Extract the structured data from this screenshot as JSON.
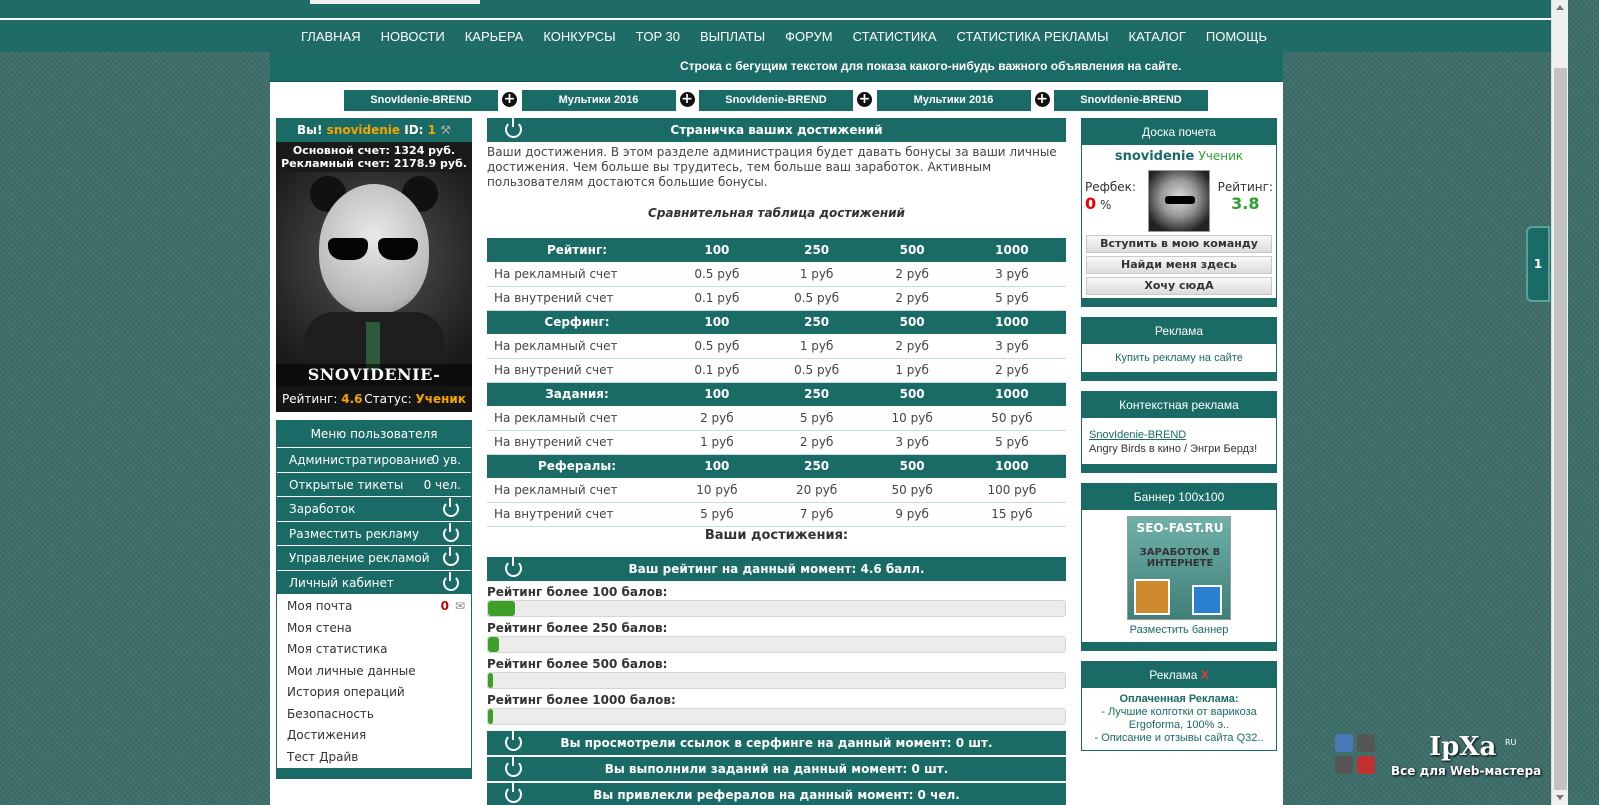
{
  "nav": [
    "ГЛАВНАЯ",
    "НОВОСТИ",
    "КАРЬЕРА",
    "КОНКУРСЫ",
    "TOP 30",
    "ВЫПЛАТЫ",
    "ФОРУМ",
    "СТАТИСТИКА",
    "СТАТИСТИКА РЕКЛАМЫ",
    "КАТАЛОГ",
    "ПОМОЩЬ"
  ],
  "marquee": "Строка с бегущим текстом для показа какого-нибудь важного объявления на сайте.",
  "tabs": [
    "SnovIdenie-BREND",
    "Мультики 2016",
    "SnovIdenie-BREND",
    "Мультики 2016",
    "SnovIdenie-BREND"
  ],
  "user": {
    "greet": "Вы!",
    "name": "snovidenie",
    "id_label": "ID:",
    "id": "1",
    "main_account": "Основной счет: 1324 руб.",
    "ad_account": "Рекламный счет: 2178.9 руб.",
    "avatar_text": "SNOVIDENIE-BREND",
    "rating_label": "Рейтинг:",
    "rating": "4.6",
    "status_label": "Статус:",
    "status": "Ученик"
  },
  "menu": {
    "title": "Меню пользователя",
    "items": [
      {
        "label": "Администратирование",
        "count": "0 ув."
      },
      {
        "label": "Открытые тикеты",
        "count": "0 чел."
      },
      {
        "label": "Заработок"
      },
      {
        "label": "Разместить рекламу"
      },
      {
        "label": "Управление рекламой"
      },
      {
        "label": "Личный кабинет"
      }
    ],
    "sub": [
      "Моя почта",
      "Моя стена",
      "Моя статистика",
      "Мои личные данные",
      "История операций",
      "Безопасность",
      "Достижения",
      "Тест Драйв"
    ],
    "mail_count": "0"
  },
  "center": {
    "header": "Страничка ваших достижений",
    "intro": "Ваши достижения. В этом разделе администрация будет давать бонусы за ваши личные достижения. Чем больше вы трудитесь, тем больше ваш заработок. Активным пользователям достаются большие бонусы.",
    "table_title": "Сравнительная таблица достижений",
    "groups": [
      {
        "name": "Рейтинг:",
        "cols": [
          "100",
          "250",
          "500",
          "1000"
        ],
        "rows": [
          {
            "label": "На рекламный счет",
            "vals": [
              "0.5 руб",
              "1 руб",
              "2 руб",
              "3 руб"
            ]
          },
          {
            "label": "На внутрений счет",
            "vals": [
              "0.1 руб",
              "0.5 руб",
              "2 руб",
              "5 руб"
            ]
          }
        ]
      },
      {
        "name": "Серфинг:",
        "cols": [
          "100",
          "250",
          "500",
          "1000"
        ],
        "rows": [
          {
            "label": "На рекламный счет",
            "vals": [
              "0.5 руб",
              "1 руб",
              "2 руб",
              "3 руб"
            ]
          },
          {
            "label": "На внутрений счет",
            "vals": [
              "0.1 руб",
              "0.5 руб",
              "1 руб",
              "2 руб"
            ]
          }
        ]
      },
      {
        "name": "Задания:",
        "cols": [
          "100",
          "250",
          "500",
          "1000"
        ],
        "rows": [
          {
            "label": "На рекламный счет",
            "vals": [
              "2 руб",
              "5 руб",
              "10 руб",
              "50 руб"
            ]
          },
          {
            "label": "На внутрений счет",
            "vals": [
              "1 руб",
              "2 руб",
              "3 руб",
              "5 руб"
            ]
          }
        ]
      },
      {
        "name": "Рефералы:",
        "cols": [
          "100",
          "250",
          "500",
          "1000"
        ],
        "rows": [
          {
            "label": "На рекламный счет",
            "vals": [
              "10 руб",
              "20 руб",
              "50 руб",
              "100 руб"
            ]
          },
          {
            "label": "На внутрений счет",
            "vals": [
              "5 руб",
              "7 руб",
              "9 руб",
              "15 руб"
            ]
          }
        ]
      }
    ],
    "your_achievements": "Ваши достижения:",
    "rating_bar": "Ваш рейтинг на данный момент: 4.6 балл.",
    "levels": [
      {
        "label": "Рейтинг более 100 балов:",
        "progress": 0.046
      },
      {
        "label": "Рейтинг более 250 балов:",
        "progress": 0.0184
      },
      {
        "label": "Рейтинг более 500 балов:",
        "progress": 0.0092
      },
      {
        "label": "Рейтинг более 1000 балов:",
        "progress": 0.0046
      }
    ],
    "surf_bar": "Вы просмотрели ссылок в серфинге на данный момент: 0 шт.",
    "tasks_bar": "Вы выполнили заданий на данный момент: 0 шт.",
    "refs_bar": "Вы привлекли рефералов на данный момент: 0 чел."
  },
  "right": {
    "honor_title": "Доска почета",
    "honor_name": "snovidenie",
    "honor_status": "Ученик",
    "refback_label": "Рефбек:",
    "refback_value": "0",
    "refback_unit": "%",
    "rating_label": "Рейтинг:",
    "rating_value": "3.8",
    "buttons": [
      "Вступить в мою команду",
      "Найди меня здесь",
      "Хочу сюдА"
    ],
    "ads_title": "Реклама",
    "ads_link": "Купить рекламу на сайте",
    "ctx_title": "Контекстная реклама",
    "ctx_link": "SnovIdenie-BREND",
    "ctx_text": "Angry Birds в кино / Энгри Бердз!",
    "banner_title": "Баннер 100x100",
    "banner_t1": "SEO-FAST.RU",
    "banner_t2": "ЗАРАБОТОК В ИНТЕРНЕТЕ",
    "banner_link": "Разместить баннер",
    "ads2_title": "Реклама",
    "ads2_x": "X",
    "paid_title": "Оплаченная Реклама:",
    "paid_items": [
      "- Лучшие колготки от варикоза Ergoforma, 100% э..",
      "- Описание и отзывы сайта Q32.."
    ]
  },
  "widget": {
    "label": "1"
  },
  "logo": {
    "brand": "IpXa",
    "ru": "RU",
    "tagline": "Все для Web-мастера"
  },
  "colors": {
    "accent": "#1a6b65",
    "orange": "#f6a400",
    "green": "#3da028"
  }
}
